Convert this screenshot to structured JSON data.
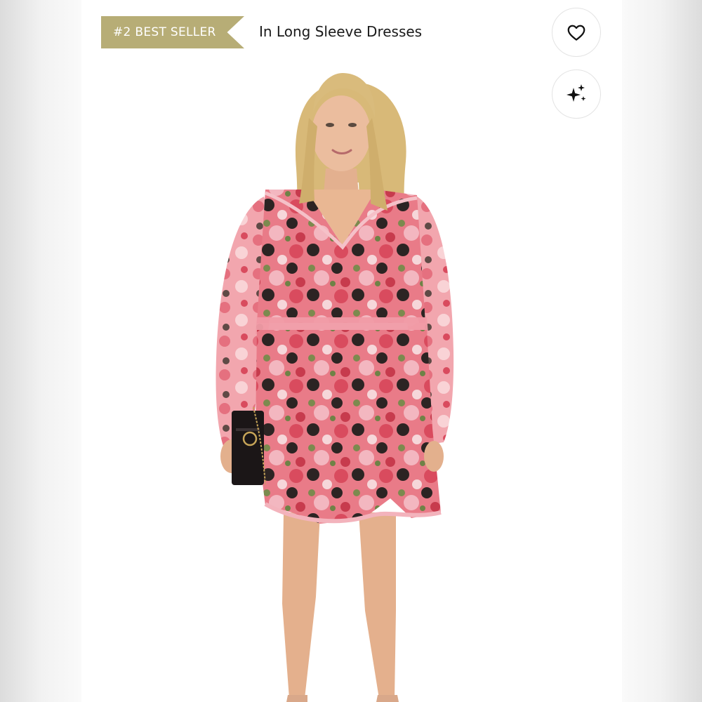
{
  "header": {
    "badge_label": "#2 BEST SELLER",
    "category_label": "In Long Sleeve Dresses"
  },
  "actions": {
    "favorite_icon": "heart-icon",
    "ai_icon": "sparkles-icon"
  },
  "photo": {
    "subject": "model-in-floral-wrap-dress",
    "colors": {
      "badge": "#b7ad76",
      "dress_pink": "#e9798a",
      "dress_dark": "#2b2423",
      "skin": "#e8b996",
      "hair": "#dcbf83"
    }
  }
}
